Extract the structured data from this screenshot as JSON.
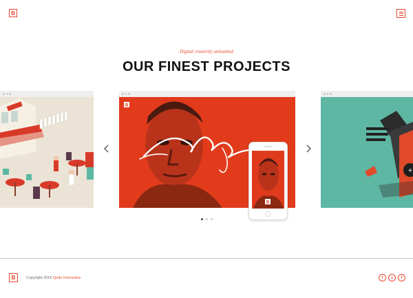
{
  "header": {
    "logo_letter": "B"
  },
  "hero": {
    "tagline": "Digital creativity unleashed",
    "title": "OUR FINEST PROJECTS"
  },
  "carousel": {
    "slide_count": 3,
    "active_index": 0
  },
  "footer": {
    "logo_letter": "B",
    "copyright_text": "Copyright 2016",
    "copyright_brand": "Qode Interactive.",
    "social": [
      "twitter-icon",
      "instagram-icon",
      "facebook-icon"
    ],
    "social_glyphs": [
      "t",
      "◘",
      "f"
    ]
  },
  "colors": {
    "accent": "#e8472c",
    "teal": "#5cb8a4",
    "slide_red": "#e03a1c"
  }
}
